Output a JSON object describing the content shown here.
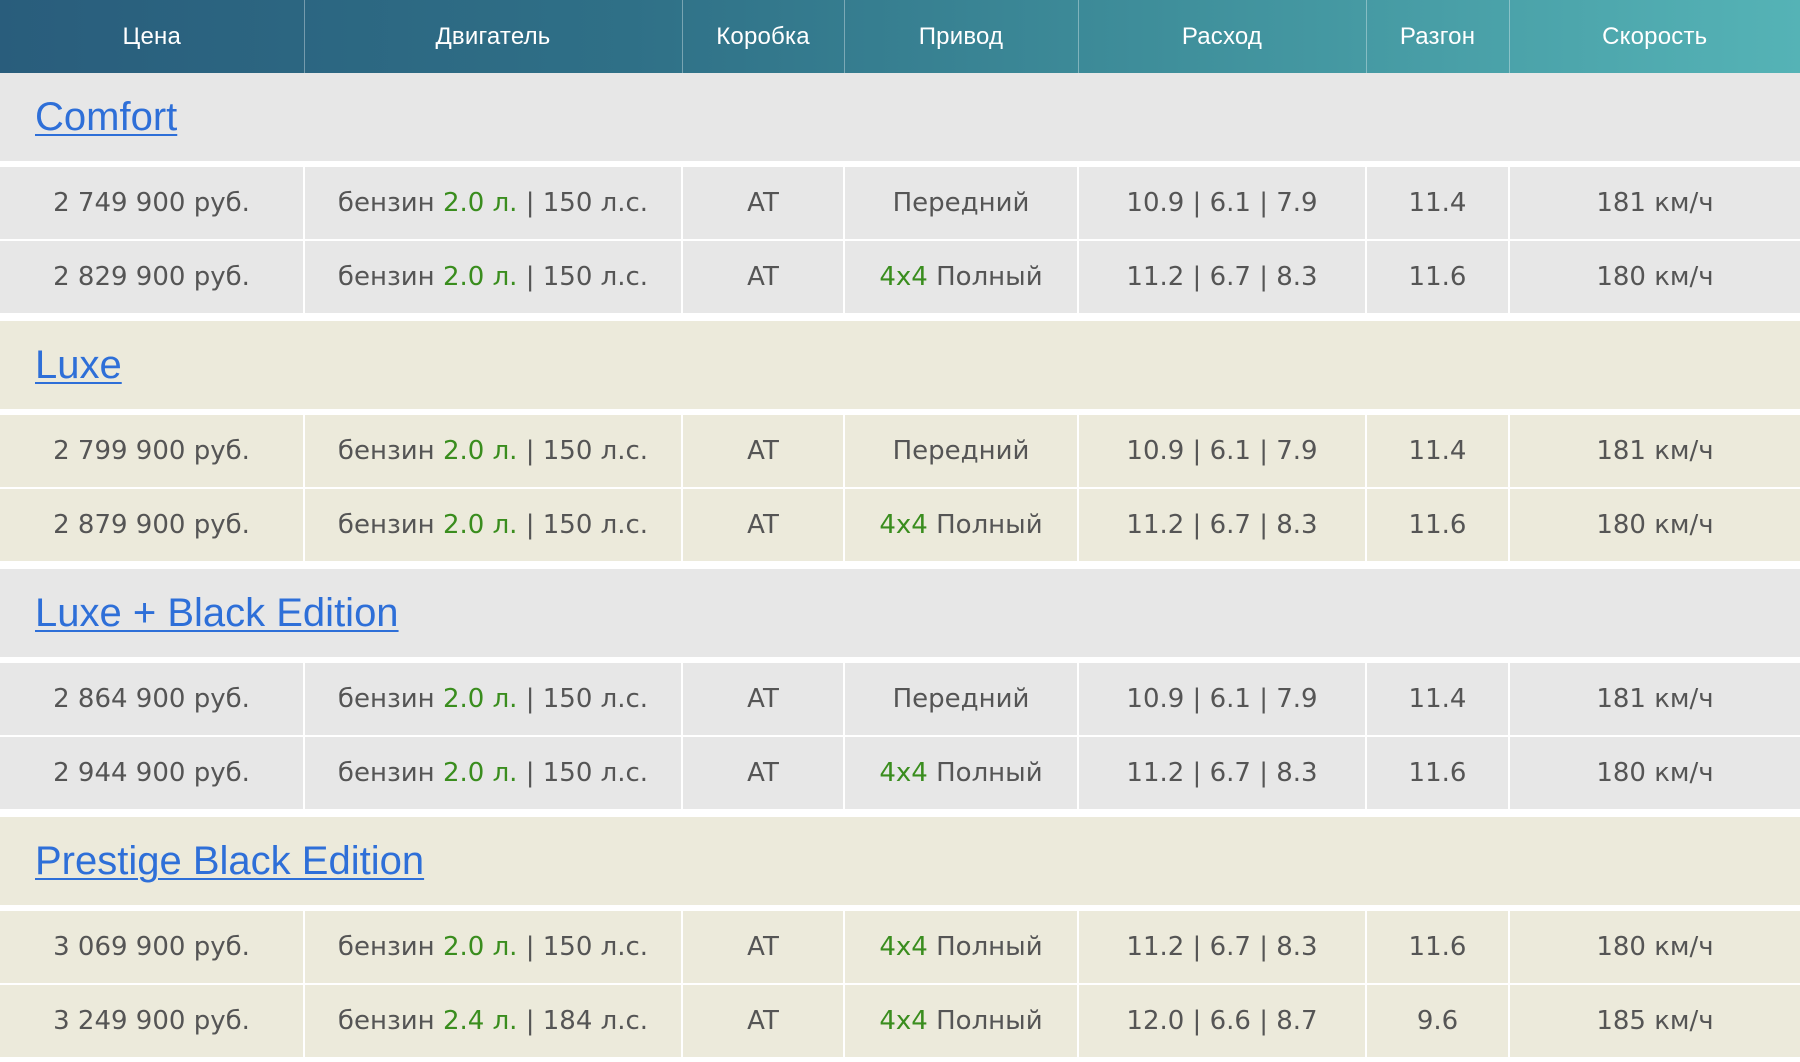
{
  "colors": {
    "header_gradient": [
      "#295d7c",
      "#55b3b6"
    ],
    "header_text": "#ffffff",
    "link": "#2e6fd8",
    "cell_text": "#555555",
    "highlight_green": "#3a8d1e",
    "band_grey": "#e7e7e7",
    "band_beige": "#eceadb"
  },
  "header": {
    "columns": [
      "Цена",
      "Двигатель",
      "Коробка",
      "Привод",
      "Расход",
      "Разгон",
      "Скорость"
    ]
  },
  "groups": [
    {
      "name": "Comfort",
      "rows": [
        {
          "price": "2 749 900 руб.",
          "fuel": "бензин",
          "volume": "2.0 л.",
          "power": "| 150 л.с.",
          "gearbox": "AT",
          "drive_prefix": "",
          "drive": "Передний",
          "consumption": "10.9 | 6.1 | 7.9",
          "accel": "11.4",
          "speed": "181 км/ч"
        },
        {
          "price": "2 829 900 руб.",
          "fuel": "бензин",
          "volume": "2.0 л.",
          "power": "| 150 л.с.",
          "gearbox": "AT",
          "drive_prefix": "4x4",
          "drive": "Полный",
          "consumption": "11.2 | 6.7 | 8.3",
          "accel": "11.6",
          "speed": "180 км/ч"
        }
      ]
    },
    {
      "name": "Luxe",
      "rows": [
        {
          "price": "2 799 900 руб.",
          "fuel": "бензин",
          "volume": "2.0 л.",
          "power": "| 150 л.с.",
          "gearbox": "AT",
          "drive_prefix": "",
          "drive": "Передний",
          "consumption": "10.9 | 6.1 | 7.9",
          "accel": "11.4",
          "speed": "181 км/ч"
        },
        {
          "price": "2 879 900 руб.",
          "fuel": "бензин",
          "volume": "2.0 л.",
          "power": "| 150 л.с.",
          "gearbox": "AT",
          "drive_prefix": "4x4",
          "drive": "Полный",
          "consumption": "11.2 | 6.7 | 8.3",
          "accel": "11.6",
          "speed": "180 км/ч"
        }
      ]
    },
    {
      "name": "Luxe + Black Edition",
      "rows": [
        {
          "price": "2 864 900 руб.",
          "fuel": "бензин",
          "volume": "2.0 л.",
          "power": "| 150 л.с.",
          "gearbox": "AT",
          "drive_prefix": "",
          "drive": "Передний",
          "consumption": "10.9 | 6.1 | 7.9",
          "accel": "11.4",
          "speed": "181 км/ч"
        },
        {
          "price": "2 944 900 руб.",
          "fuel": "бензин",
          "volume": "2.0 л.",
          "power": "| 150 л.с.",
          "gearbox": "AT",
          "drive_prefix": "4x4",
          "drive": "Полный",
          "consumption": "11.2 | 6.7 | 8.3",
          "accel": "11.6",
          "speed": "180 км/ч"
        }
      ]
    },
    {
      "name": "Prestige Black Edition",
      "rows": [
        {
          "price": "3 069 900 руб.",
          "fuel": "бензин",
          "volume": "2.0 л.",
          "power": "| 150 л.с.",
          "gearbox": "AT",
          "drive_prefix": "4x4",
          "drive": "Полный",
          "consumption": "11.2 | 6.7 | 8.3",
          "accel": "11.6",
          "speed": "180 км/ч"
        },
        {
          "price": "3 249 900 руб.",
          "fuel": "бензин",
          "volume": "2.4 л.",
          "power": "| 184 л.с.",
          "gearbox": "AT",
          "drive_prefix": "4x4",
          "drive": "Полный",
          "consumption": "12.0 | 6.6 | 8.7",
          "accel": "9.6",
          "speed": "185 км/ч"
        }
      ]
    }
  ]
}
